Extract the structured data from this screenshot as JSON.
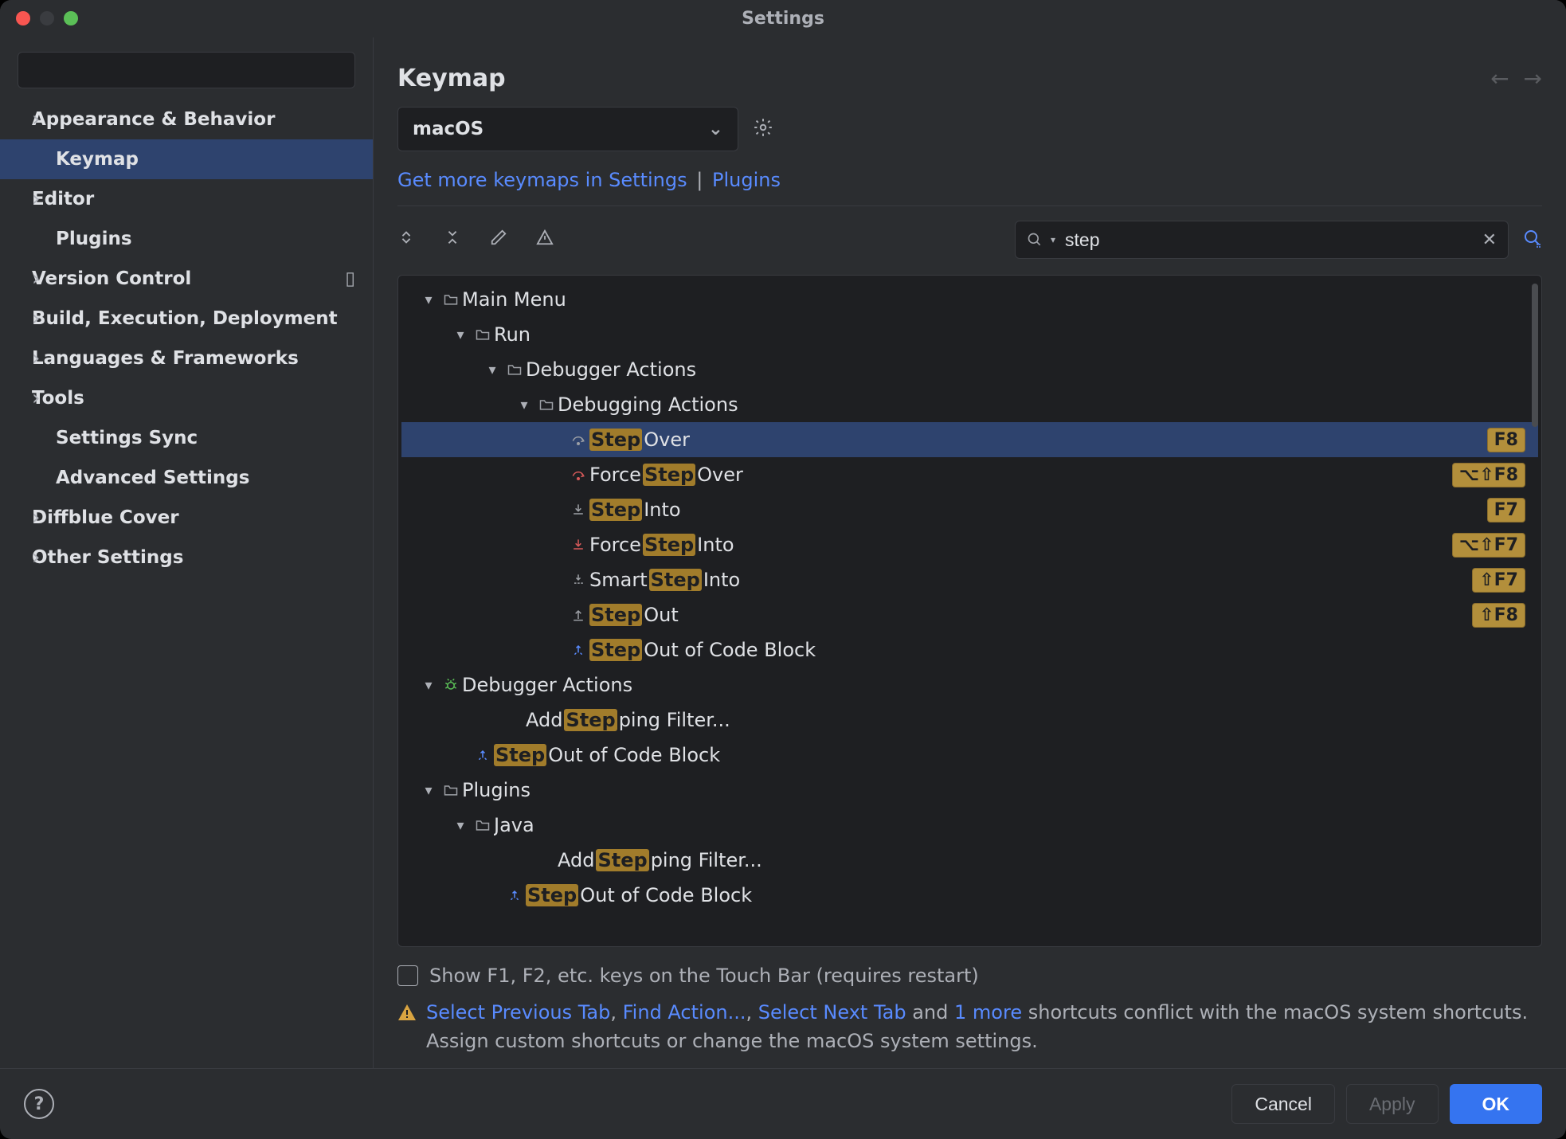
{
  "window": {
    "title": "Settings"
  },
  "sidebar": {
    "search_placeholder": "",
    "items": [
      {
        "label": "Appearance & Behavior",
        "expandable": true,
        "indent": 1
      },
      {
        "label": "Keymap",
        "expandable": false,
        "indent": 2,
        "selected": true
      },
      {
        "label": "Editor",
        "expandable": true,
        "indent": 1
      },
      {
        "label": "Plugins",
        "expandable": false,
        "indent": 2
      },
      {
        "label": "Version Control",
        "expandable": true,
        "indent": 1,
        "badge": "separator"
      },
      {
        "label": "Build, Execution, Deployment",
        "expandable": true,
        "indent": 1
      },
      {
        "label": "Languages & Frameworks",
        "expandable": true,
        "indent": 1
      },
      {
        "label": "Tools",
        "expandable": true,
        "indent": 1
      },
      {
        "label": "Settings Sync",
        "expandable": false,
        "indent": 2
      },
      {
        "label": "Advanced Settings",
        "expandable": false,
        "indent": 2
      },
      {
        "label": "Diffblue Cover",
        "expandable": true,
        "indent": 1
      },
      {
        "label": "Other Settings",
        "expandable": true,
        "indent": 1
      }
    ]
  },
  "main": {
    "title": "Keymap",
    "keymap_selected": "macOS",
    "keymaps_link": "Get more keymaps in Settings",
    "plugins_link": "Plugins",
    "search_value": "step",
    "tree": [
      {
        "depth": 0,
        "chev": "open",
        "icon": "folder",
        "parts": [
          {
            "t": "Main Menu"
          }
        ]
      },
      {
        "depth": 1,
        "chev": "open",
        "icon": "folder",
        "parts": [
          {
            "t": "Run"
          }
        ]
      },
      {
        "depth": 2,
        "chev": "open",
        "icon": "folder",
        "parts": [
          {
            "t": "Debugger Actions"
          }
        ]
      },
      {
        "depth": 3,
        "chev": "open",
        "icon": "folder",
        "parts": [
          {
            "t": "Debugging Actions"
          }
        ]
      },
      {
        "depth": 4,
        "chev": "none",
        "icon": "step-over",
        "parts": [
          {
            "t": "Step",
            "h": true
          },
          {
            "t": " Over"
          }
        ],
        "shortcut": "F8",
        "selected": true
      },
      {
        "depth": 4,
        "chev": "none",
        "icon": "force-over",
        "parts": [
          {
            "t": "Force "
          },
          {
            "t": "Step",
            "h": true
          },
          {
            "t": " Over"
          }
        ],
        "shortcut": "⌥⇧F8"
      },
      {
        "depth": 4,
        "chev": "none",
        "icon": "step-into",
        "parts": [
          {
            "t": "Step",
            "h": true
          },
          {
            "t": " Into"
          }
        ],
        "shortcut": "F7"
      },
      {
        "depth": 4,
        "chev": "none",
        "icon": "force-into",
        "parts": [
          {
            "t": "Force "
          },
          {
            "t": "Step",
            "h": true
          },
          {
            "t": " Into"
          }
        ],
        "shortcut": "⌥⇧F7"
      },
      {
        "depth": 4,
        "chev": "none",
        "icon": "smart-into",
        "parts": [
          {
            "t": "Smart "
          },
          {
            "t": "Step",
            "h": true
          },
          {
            "t": " Into"
          }
        ],
        "shortcut": "⇧F7"
      },
      {
        "depth": 4,
        "chev": "none",
        "icon": "step-out",
        "parts": [
          {
            "t": "Step",
            "h": true
          },
          {
            "t": " Out"
          }
        ],
        "shortcut": "⇧F8"
      },
      {
        "depth": 4,
        "chev": "none",
        "icon": "step-out-block",
        "parts": [
          {
            "t": "Step",
            "h": true
          },
          {
            "t": " Out of Code Block"
          }
        ]
      },
      {
        "depth": 0,
        "chev": "open",
        "icon": "bug",
        "parts": [
          {
            "t": "Debugger Actions"
          }
        ]
      },
      {
        "depth": 2,
        "chev": "none",
        "icon": "",
        "parts": [
          {
            "t": "Add "
          },
          {
            "t": "Step",
            "h": true
          },
          {
            "t": "ping Filter..."
          }
        ]
      },
      {
        "depth": 1,
        "chev": "none",
        "icon": "step-out-block",
        "parts": [
          {
            "t": "Step",
            "h": true
          },
          {
            "t": " Out of Code Block"
          }
        ]
      },
      {
        "depth": 0,
        "chev": "open",
        "icon": "folder",
        "parts": [
          {
            "t": "Plugins"
          }
        ]
      },
      {
        "depth": 1,
        "chev": "open",
        "icon": "folder",
        "parts": [
          {
            "t": "Java"
          }
        ]
      },
      {
        "depth": 3,
        "chev": "none",
        "icon": "",
        "parts": [
          {
            "t": "Add "
          },
          {
            "t": "Step",
            "h": true
          },
          {
            "t": "ping Filter..."
          }
        ]
      },
      {
        "depth": 2,
        "chev": "none",
        "icon": "step-out-block",
        "parts": [
          {
            "t": "Step",
            "h": true
          },
          {
            "t": " Out of Code Block"
          }
        ]
      }
    ],
    "touchbar_checkbox": "Show F1, F2, etc. keys on the Touch Bar (requires restart)",
    "warning": {
      "links": [
        "Select Previous Tab",
        "Find Action...",
        "Select Next Tab",
        "1 more"
      ],
      "mid1": ", ",
      "mid2": ", ",
      "mid3": " and ",
      "tail": " shortcuts conflict with the macOS system shortcuts. Assign custom shortcuts or change the macOS system settings."
    }
  },
  "buttons": {
    "cancel": "Cancel",
    "apply": "Apply",
    "ok": "OK"
  }
}
